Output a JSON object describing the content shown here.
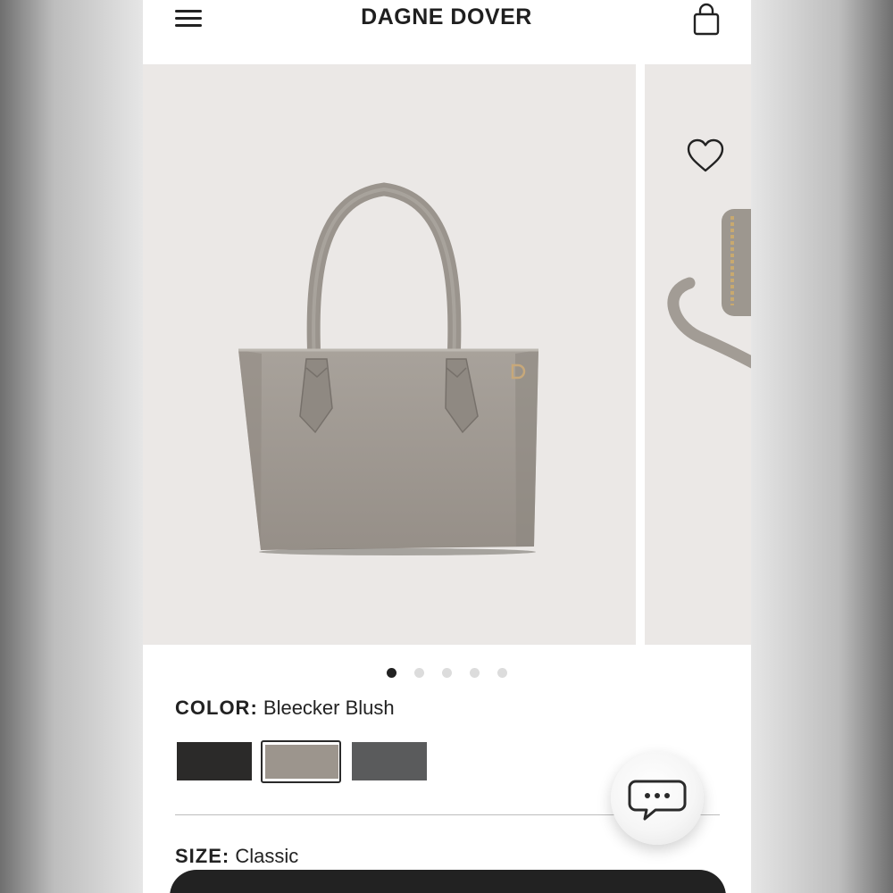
{
  "header": {
    "brand": "DAGNE DOVER",
    "menu_icon": "hamburger-menu-icon",
    "cart_icon": "shopping-bag-icon"
  },
  "gallery": {
    "wishlist_icon": "heart-icon",
    "slide_count": 5,
    "active_slide": 1
  },
  "color": {
    "label": "COLOR:",
    "value": "Bleecker Blush",
    "swatches": [
      {
        "color": "#2b2a29",
        "selected": false
      },
      {
        "color": "#9c958d",
        "selected": true
      },
      {
        "color": "#5a5b5c",
        "selected": false
      }
    ]
  },
  "size": {
    "label": "SIZE:",
    "value": "Classic"
  },
  "chat": {
    "icon": "chat-bubble-icon"
  },
  "colors": {
    "text": "#222222",
    "image_background": "#ebe8e6",
    "bag": "#9e9891"
  }
}
